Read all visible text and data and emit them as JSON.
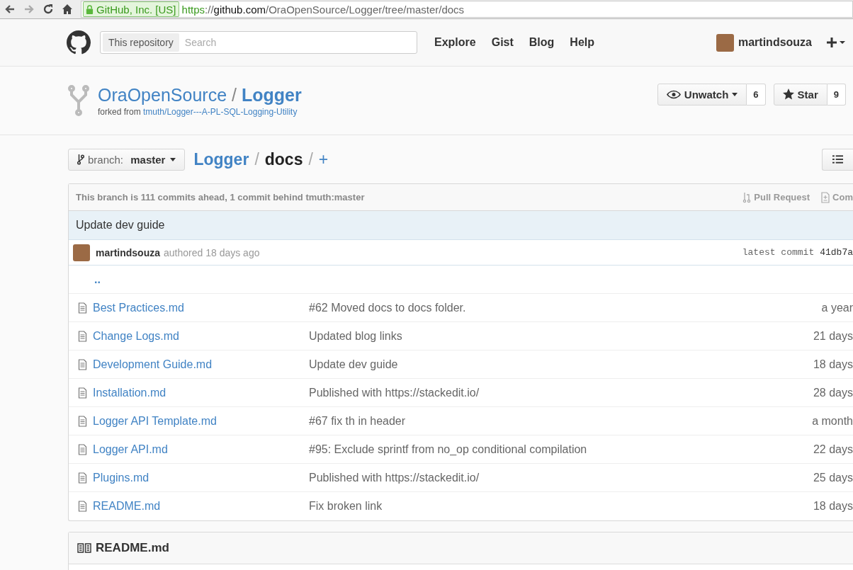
{
  "browser": {
    "ev_label": "GitHub, Inc. [US]",
    "url": [
      {
        "text": "https",
        "kind": "scheme"
      },
      {
        "text": "://",
        "kind": "plain"
      },
      {
        "text": "github.com",
        "kind": "host"
      },
      {
        "text": "/OraOpenSource/Logger/tree/master/docs",
        "kind": "plain"
      }
    ]
  },
  "header": {
    "scope": "This repository",
    "search_placeholder": "Search",
    "nav": [
      "Explore",
      "Gist",
      "Blog",
      "Help"
    ],
    "username": "martindsouza"
  },
  "repo": {
    "owner": "OraOpenSource",
    "separator": "/",
    "name": "Logger",
    "forked_prefix": "forked from",
    "forked_from": "tmuth/Logger---A-PL-SQL-Logging-Utility",
    "watch_label": "Unwatch",
    "watch_count": "6",
    "star_label": "Star",
    "star_count": "9"
  },
  "branch": {
    "prefix": "branch:",
    "name": "master"
  },
  "breadcrumb": {
    "root": "Logger",
    "separator_1": "/",
    "current": "docs",
    "separator_2": "/",
    "add": "+"
  },
  "tracking": {
    "text": "This branch is 111 commits ahead, 1 commit behind tmuth:master",
    "actions": [
      {
        "label": "Pull Request",
        "kind": "pull"
      },
      {
        "label": "Com",
        "kind": "compare"
      }
    ]
  },
  "commit": {
    "message": "Update dev guide",
    "author": "martindsouza",
    "authored": "authored 18 days ago",
    "latest_label": "latest commit",
    "sha": "41db7a"
  },
  "parent_link": "..",
  "files": [
    {
      "name": "Best Practices.md",
      "message": "#62 Moved docs to docs folder.",
      "age": "a year"
    },
    {
      "name": "Change Logs.md",
      "message": "Updated blog links",
      "age": "21 days"
    },
    {
      "name": "Development Guide.md",
      "message": "Update dev guide",
      "age": "18 days"
    },
    {
      "name": "Installation.md",
      "message": "Published with https://stackedit.io/",
      "age": "28 days"
    },
    {
      "name": "Logger API Template.md",
      "message": "#67 fix th in header",
      "age": "a month"
    },
    {
      "name": "Logger API.md",
      "message": "#95: Exclude sprintf from no_op conditional compilation",
      "age": "22 days"
    },
    {
      "name": "Plugins.md",
      "message": "Published with https://stackedit.io/",
      "age": "25 days"
    },
    {
      "name": "README.md",
      "message": "Fix broken link",
      "age": "18 days"
    }
  ],
  "readme": {
    "title": "README.md"
  }
}
